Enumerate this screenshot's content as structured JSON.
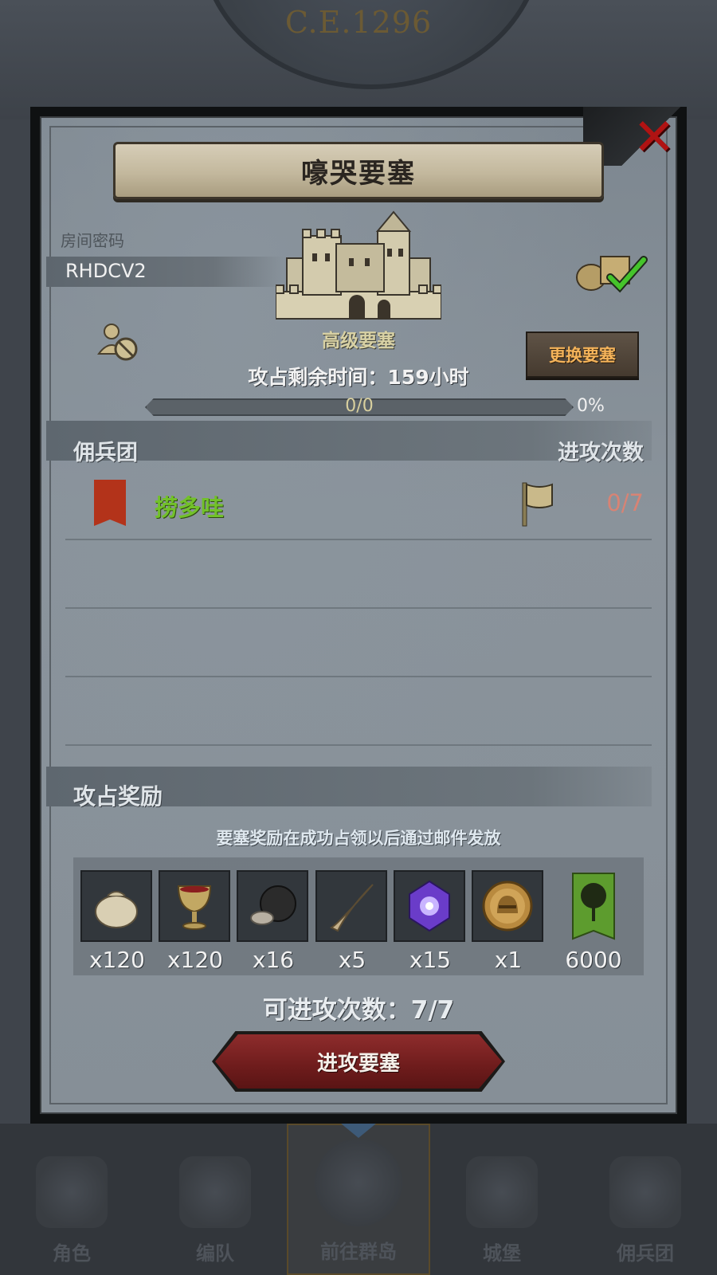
{
  "background": {
    "era": "C.E.1296",
    "bottom_nav": [
      {
        "label": "角色",
        "icon": "knight-icon",
        "active": false
      },
      {
        "label": "编队",
        "icon": "helmet-icon",
        "active": false
      },
      {
        "label": "前往群岛",
        "icon": "globe-icon",
        "active": true
      },
      {
        "label": "城堡",
        "icon": "castle-icon",
        "active": false
      },
      {
        "label": "佣兵团",
        "icon": "mercenary-icon",
        "active": false
      }
    ]
  },
  "modal": {
    "title": "嚎哭要塞",
    "close_icon": "close-icon"
  },
  "room": {
    "label": "房间密码",
    "code": "RHDCV2"
  },
  "fortress": {
    "grade": "高级要塞",
    "timer": "攻占剩余时间：159小时",
    "change_button": "更换要塞",
    "progress_text": "0/0",
    "progress_percent": "0%",
    "progress_value": 0
  },
  "list": {
    "header_left": "佣兵团",
    "header_right": "进攻次数",
    "rows": [
      {
        "name": "捞多哇",
        "count": "0/7",
        "banner_color": "#b3331a"
      }
    ]
  },
  "rewards": {
    "header": "攻占奖励",
    "note": "要塞奖励在成功占领以后通过邮件发放",
    "items": [
      {
        "icon": "sack-icon",
        "qty": "x120"
      },
      {
        "icon": "goblet-icon",
        "qty": "x120"
      },
      {
        "icon": "ore-icon",
        "qty": "x16"
      },
      {
        "icon": "horn-icon",
        "qty": "x5"
      },
      {
        "icon": "purple-gem-icon",
        "qty": "x15"
      },
      {
        "icon": "helmet-medal-icon",
        "qty": "x1"
      },
      {
        "icon": "tree-banner-icon",
        "qty": "6000"
      }
    ]
  },
  "footer": {
    "attacks_left": "可进攻次数：7/7",
    "attack_button": "进攻要塞"
  },
  "colors": {
    "accent_orange": "#f4b35a",
    "guild_green": "#72c12a",
    "count_red": "#d88374",
    "button_red": "#8e2c2c",
    "close_red": "#b01313"
  }
}
